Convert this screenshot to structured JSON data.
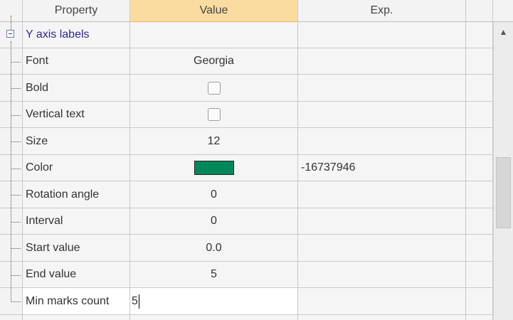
{
  "columns": {
    "property": "Property",
    "value": "Value",
    "exp": "Exp."
  },
  "group": {
    "label": "Y axis labels"
  },
  "rows": [
    {
      "label": "Font",
      "value": "Georgia",
      "exp": ""
    },
    {
      "label": "Bold",
      "checked": false,
      "exp": ""
    },
    {
      "label": "Vertical text",
      "checked": false,
      "exp": ""
    },
    {
      "label": "Size",
      "value": "12",
      "exp": ""
    },
    {
      "label": "Color",
      "color": "#00875a",
      "exp": "-16737946"
    },
    {
      "label": "Rotation angle",
      "value": "0",
      "exp": ""
    },
    {
      "label": "Interval",
      "value": "0",
      "exp": ""
    },
    {
      "label": "Start value",
      "value": "0.0",
      "exp": ""
    },
    {
      "label": "End value",
      "value": "5",
      "exp": ""
    },
    {
      "label": "Min marks count",
      "value": "5",
      "exp": "",
      "editing": true
    }
  ],
  "scrollbar": {
    "up_icon": "chevron-up-icon"
  }
}
